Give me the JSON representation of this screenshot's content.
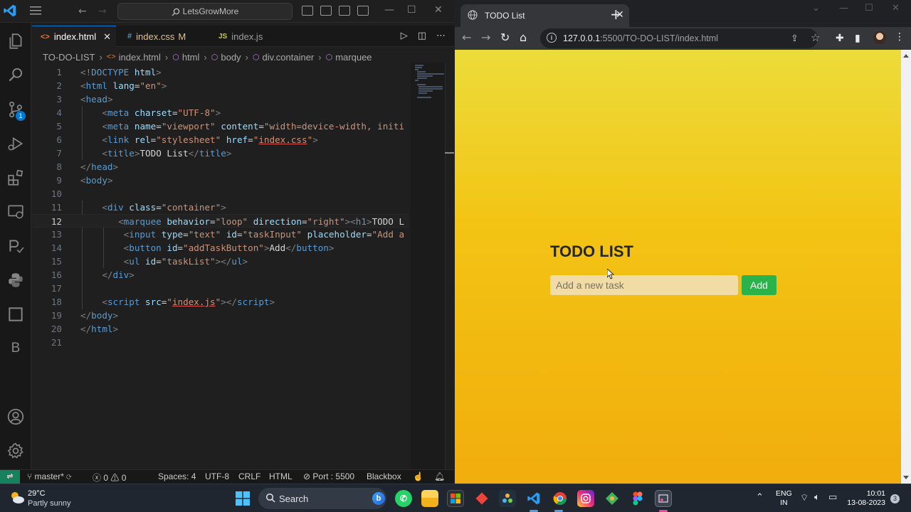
{
  "vscode": {
    "search_text": "LetsGrowMore",
    "tabs": [
      {
        "icon": "<>",
        "label": "index.html",
        "active": true
      },
      {
        "icon": "#",
        "label": "index.css",
        "modified": "M"
      },
      {
        "icon": "JS",
        "label": "index.js"
      }
    ],
    "activity_badge": "1",
    "activity_letter": "B",
    "breadcrumb": [
      "TO-DO-LIST",
      "index.html",
      "html",
      "body",
      "div.container",
      "marquee"
    ],
    "line_numbers": [
      "1",
      "2",
      "3",
      "4",
      "5",
      "6",
      "7",
      "8",
      "9",
      "10",
      "11",
      "12",
      "13",
      "14",
      "15",
      "16",
      "17",
      "18",
      "19",
      "20",
      "21"
    ],
    "code": {
      "l1_open": "<!",
      "l1_tag": "DOCTYPE",
      "l1_attr": " html",
      "l1_close": ">",
      "l2_tag": "html",
      "l2_attr": "lang",
      "l2_val": "\"en\"",
      "l3_tag": "head",
      "l4_tag": "meta",
      "l4_attr": "charset",
      "l4_val": "\"UTF-8\"",
      "l5_tag": "meta",
      "l5_attr1": "name",
      "l5_val1": "\"viewport\"",
      "l5_attr2": "content",
      "l5_val2": "\"width=device-width, initi",
      "l6_tag": "link",
      "l6_attr1": "rel",
      "l6_val1": "\"stylesheet\"",
      "l6_attr2": "href",
      "l6_val2a": "\"",
      "l6_val2b": "index.css",
      "l6_val2c": "\"",
      "l7_tag": "title",
      "l7_text": "TODO List",
      "l7_endtag": "title",
      "l8_tag": "head",
      "l9_tag": "body",
      "l11_tag": "div",
      "l11_attr": "class",
      "l11_val": "\"container\"",
      "l12_tag": "marquee",
      "l12_attr1": "behavior",
      "l12_val1": "\"loop\"",
      "l12_attr2": "direction",
      "l12_val2": "\"right\"",
      "l12_tag2": "h1",
      "l12_text": "TODO L",
      "l13_tag": "input",
      "l13_attr1": "type",
      "l13_val1": "\"text\"",
      "l13_attr2": "id",
      "l13_val2": "\"taskInput\"",
      "l13_attr3": "placeholder",
      "l13_val3": "\"Add a",
      "l14_tag": "button",
      "l14_attr": "id",
      "l14_val": "\"addTaskButton\"",
      "l14_text": "Add",
      "l14_endtag": "button",
      "l15_tag": "ul",
      "l15_attr": "id",
      "l15_val": "\"taskList\"",
      "l15_endtag": "ul",
      "l16_tag": "div",
      "l18_tag": "script",
      "l18_attr": "src",
      "l18_val_a": "\"",
      "l18_val_b": "index.js",
      "l18_val_c": "\"",
      "l18_endtag": "script",
      "l19_tag": "body",
      "l20_tag": "html"
    },
    "status": {
      "branch": "master*",
      "errors": "0",
      "warnings": "0",
      "spaces": "Spaces: 4",
      "encoding": "UTF-8",
      "eol": "CRLF",
      "language": "HTML",
      "port": "Port : 5500",
      "extension": "Blackbox"
    }
  },
  "chrome": {
    "tab_title": "TODO List",
    "url_host": "127.0.0.1",
    "url_path": ":5500/TO-DO-LIST/index.html"
  },
  "page": {
    "heading": "TODO LIST",
    "input_placeholder": "Add a new task",
    "add_button": "Add"
  },
  "taskbar": {
    "temperature": "29°C",
    "weather": "Partly sunny",
    "search_label": "Search",
    "lang_line1": "ENG",
    "lang_line2": "IN",
    "time": "10:01",
    "date": "13-08-2023",
    "notifications": "3"
  },
  "colors": {
    "vscode_bg": "#1f1f1f",
    "accent": "#0078d4",
    "page_gradient_top": "#ecdc3a",
    "page_gradient_bottom": "#f1ad0c",
    "add_button": "#2bb34b"
  }
}
